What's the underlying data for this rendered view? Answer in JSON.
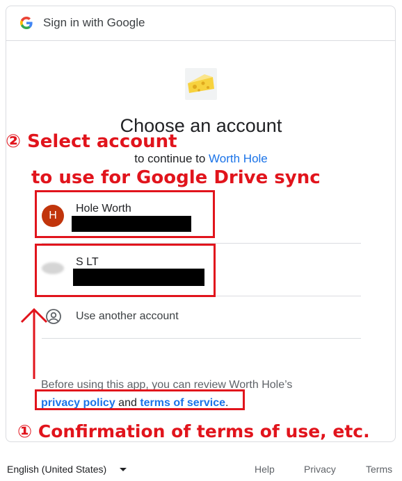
{
  "header": {
    "title": "Sign in with Google",
    "logo_icon": "google-g-icon"
  },
  "app": {
    "logo_icon": "cheese-icon",
    "name": "Worth Hole"
  },
  "page": {
    "heading": "Choose an account",
    "subheading_prefix": "to continue to"
  },
  "accounts": [
    {
      "avatar_letter": "H",
      "name": "Hole Worth",
      "avatar_color": "#c1350c"
    },
    {
      "avatar_letter": "",
      "name": "S LT",
      "avatar_color": "#d5d5d5"
    }
  ],
  "use_another": {
    "label": "Use another account"
  },
  "policy": {
    "line1": "Before using this app, you can review Worth Hole’s",
    "privacy_label": "privacy policy",
    "and_text": " and ",
    "terms_label": "terms of service",
    "period": "."
  },
  "annotations": {
    "step2_line1": "② Select account",
    "step2_line2": "to use for Google Drive sync",
    "step1": "① Confirmation of terms of use, etc.",
    "color": "#e1141c"
  },
  "footer": {
    "language": "English (United States)",
    "help": "Help",
    "privacy": "Privacy",
    "terms": "Terms"
  },
  "colors": {
    "link": "#1a73e8",
    "border": "#dadce0"
  }
}
